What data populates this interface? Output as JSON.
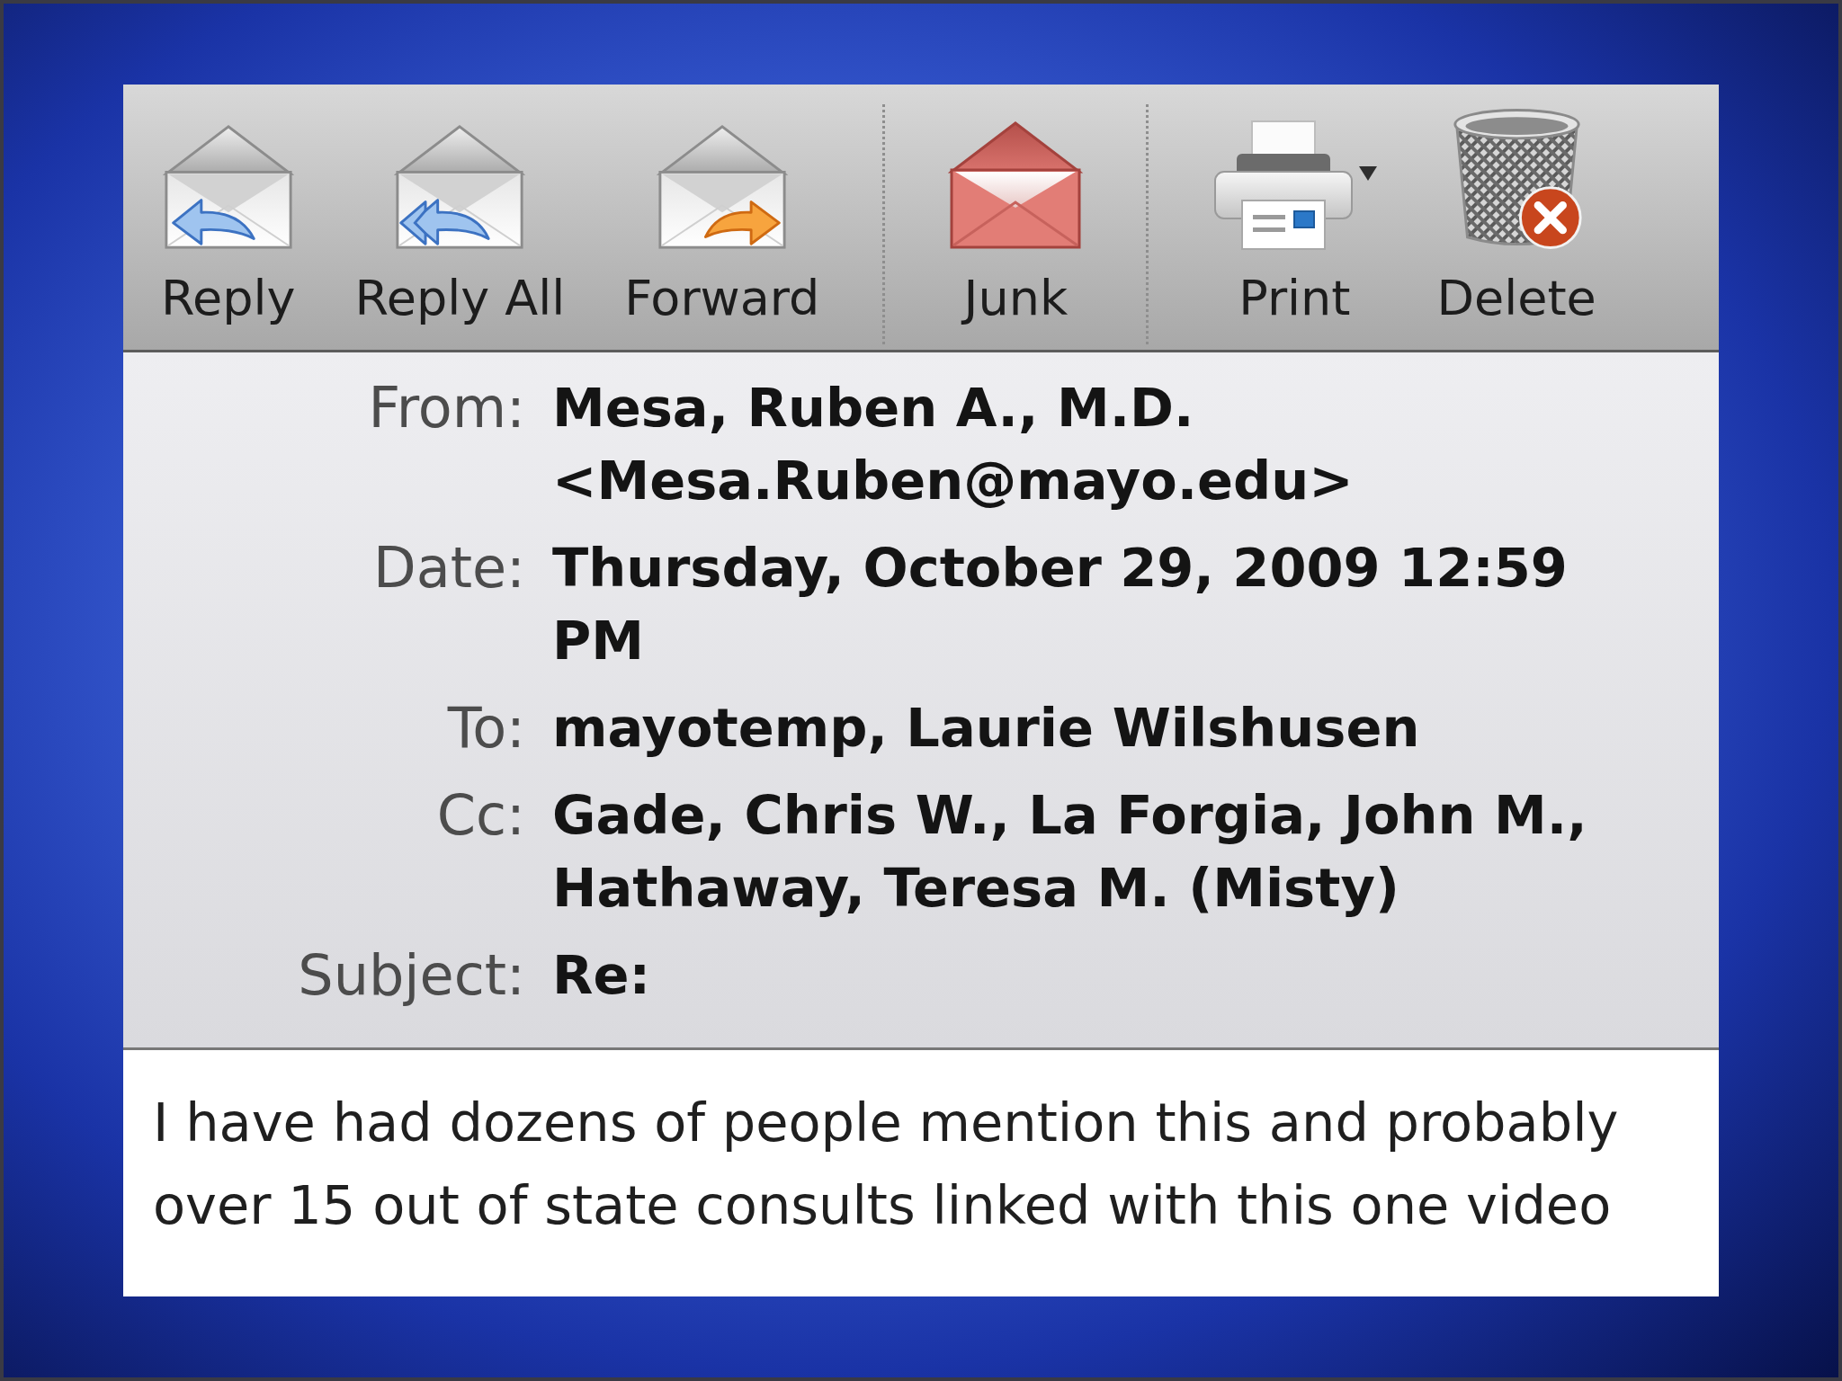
{
  "toolbar": {
    "groups": [
      {
        "buttons": [
          {
            "label": "Reply",
            "dropdown": false
          },
          {
            "label": "Reply All",
            "dropdown": false
          },
          {
            "label": "Forward",
            "dropdown": false
          }
        ]
      },
      {
        "buttons": [
          {
            "label": "Junk",
            "dropdown": false
          }
        ]
      },
      {
        "buttons": [
          {
            "label": "Print",
            "dropdown": true
          },
          {
            "label": "Delete",
            "dropdown": false
          }
        ]
      }
    ]
  },
  "headers": [
    {
      "label": "From:",
      "value": "Mesa, Ruben A., M.D. <Mesa.Ruben@mayo.edu>"
    },
    {
      "label": "Date:",
      "value": "Thursday, October 29, 2009 12:59 PM"
    },
    {
      "label": "To:",
      "value": "mayotemp, Laurie Wilshusen"
    },
    {
      "label": "Cc:",
      "value": "Gade, Chris W., La Forgia, John M., Hathaway, Teresa M. (Misty)"
    },
    {
      "label": "Subject:",
      "value": "Re:"
    }
  ],
  "body": {
    "text": "I have had dozens of people mention this and probably over 15 out of state consults linked with this one video"
  }
}
